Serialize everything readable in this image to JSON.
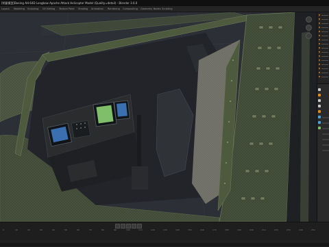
{
  "window": {
    "title": "[明星模型]Boeing AH-64D Longbow Apache Attack Helicopter Model (Quality=detail) - Blender 3.6.0"
  },
  "menu": {
    "items": [
      "Layout",
      "Modeling",
      "Sculpting",
      "UV Editing",
      "Texture Paint",
      "Shading",
      "Animation",
      "Rendering",
      "Compositing",
      "Geometry Nodes",
      "Scripting"
    ]
  },
  "timeline": {
    "frames": [
      "0",
      "10",
      "20",
      "30",
      "40",
      "50",
      "60",
      "70",
      "80",
      "90",
      "100",
      "110",
      "120",
      "130",
      "140",
      "150",
      "160",
      "170",
      "180",
      "190",
      "200",
      "210",
      "220",
      "230",
      "240",
      "250"
    ]
  },
  "colors": {
    "accent": "#e28a1f",
    "screen_green": "#7fbf6a",
    "screen_blue": "#3a6fb0",
    "hull": "#3f4a36",
    "frame": "#4d5a3e"
  },
  "icons": [
    "search-icon",
    "filter-icon",
    "wrench-icon",
    "camera-icon",
    "world-icon",
    "object-icon",
    "material-icon",
    "play-icon",
    "rewind-icon",
    "fast-forward-icon"
  ]
}
